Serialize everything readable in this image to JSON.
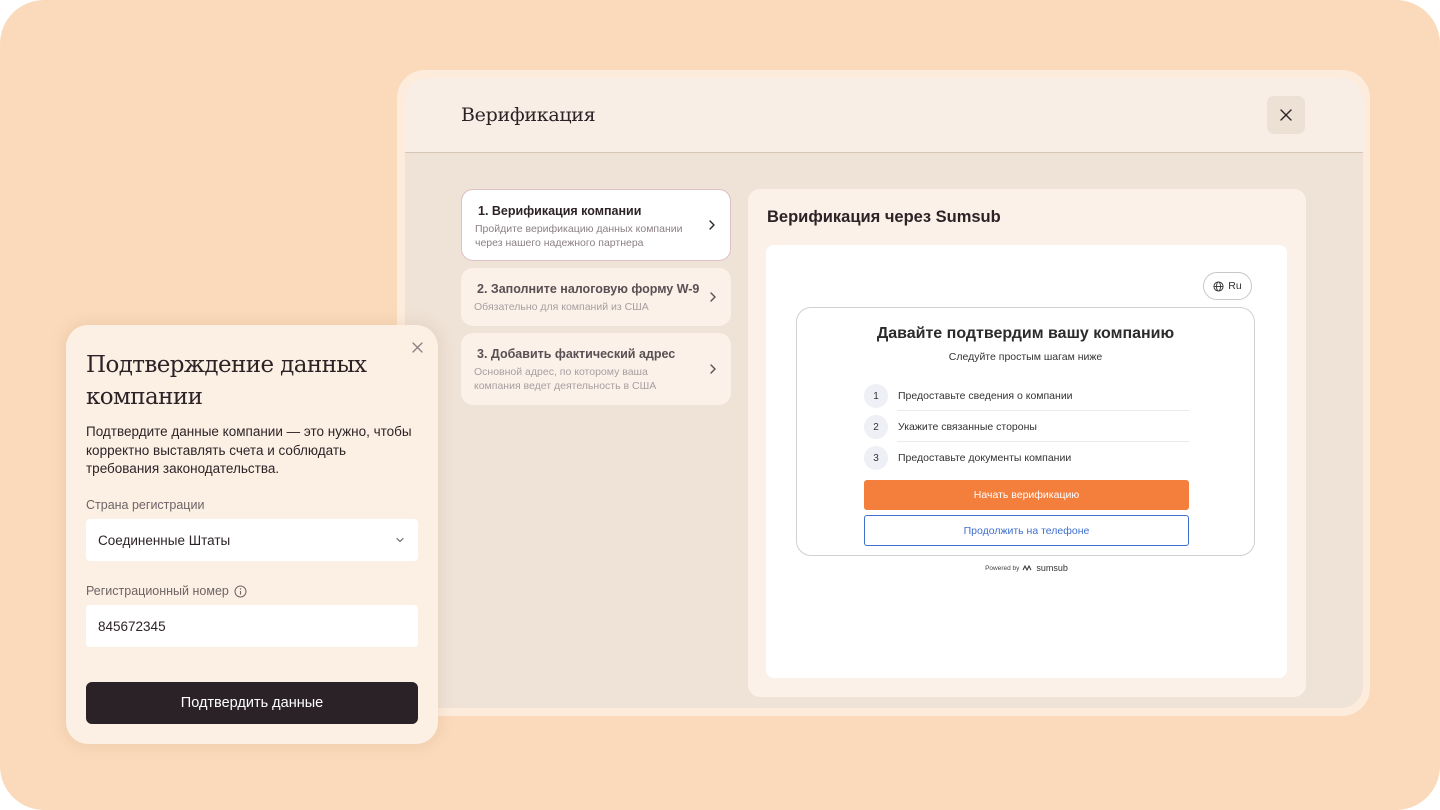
{
  "window": {
    "title": "Верификация"
  },
  "steps": [
    {
      "title": "1. Верификация компании",
      "subtitle_line1": "Пройдите верификацию данных компании",
      "subtitle_line2": "через нашего надежного партнера",
      "active": true
    },
    {
      "title": "2. Заполните налоговую форму W-9",
      "subtitle_line1": "Обязательно для компаний из США",
      "subtitle_line2": "",
      "active": false
    },
    {
      "title": "3. Добавить фактический адрес",
      "subtitle_line1": "Основной адрес, по которому ваша",
      "subtitle_line2": "компания ведет деятельность в США",
      "active": false
    }
  ],
  "panel": {
    "title": "Верификация через Sumsub",
    "language": "Ru",
    "card_title": "Давайте подтвердим вашу компанию",
    "card_subtitle": "Следуйте простым шагам ниже",
    "items": [
      {
        "num": "1",
        "text": "Предоставьте сведения о компании"
      },
      {
        "num": "2",
        "text": "Укажите связанные стороны"
      },
      {
        "num": "3",
        "text": "Предоставьте документы компании"
      }
    ],
    "primary_button": "Начать верификацию",
    "secondary_button": "Продолжить на телефоне",
    "powered_by": "Powered by",
    "powered_brand": "sumsub"
  },
  "modal": {
    "title": "Подтверждение данных компании",
    "description": "Подтвердите данные компании — это нужно, чтобы корректно выставлять счета и соблюдать требования законодательства.",
    "country_label": "Страна регистрации",
    "country_value": "Соединенные Штаты",
    "regnum_label": "Регистрационный номер",
    "regnum_value": "845672345",
    "submit_label": "Подтвердить данные"
  },
  "colors": {
    "background": "#fadabb",
    "accent_orange": "#f47e3c",
    "link_blue": "#3f6fd0",
    "dark_button": "#2a2226"
  },
  "icons": [
    "close-icon",
    "chevron-right-icon",
    "globe-icon",
    "sumsub-logo-icon",
    "chevron-down-icon",
    "info-icon"
  ]
}
